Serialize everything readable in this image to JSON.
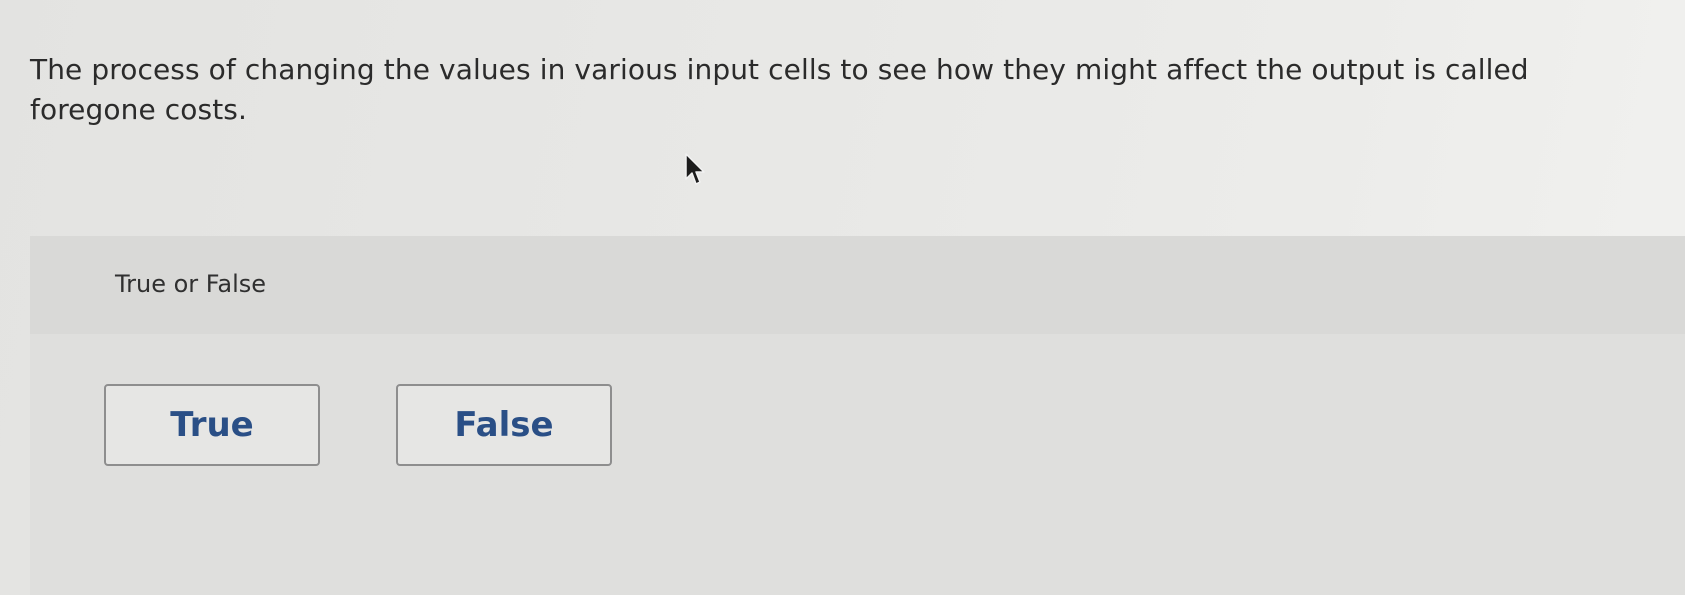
{
  "question": {
    "text": "The process of changing the values in various input cells to see how they might affect the output is called foregone costs."
  },
  "answer_area": {
    "prompt": "True or False",
    "options": [
      {
        "label": "True"
      },
      {
        "label": "False"
      }
    ]
  },
  "icons": {
    "cursor": "mouse-pointer-icon"
  },
  "colors": {
    "option_text": "#2a4f86",
    "panel_background": "#dfdfdd",
    "page_background": "#e8e8e6"
  }
}
